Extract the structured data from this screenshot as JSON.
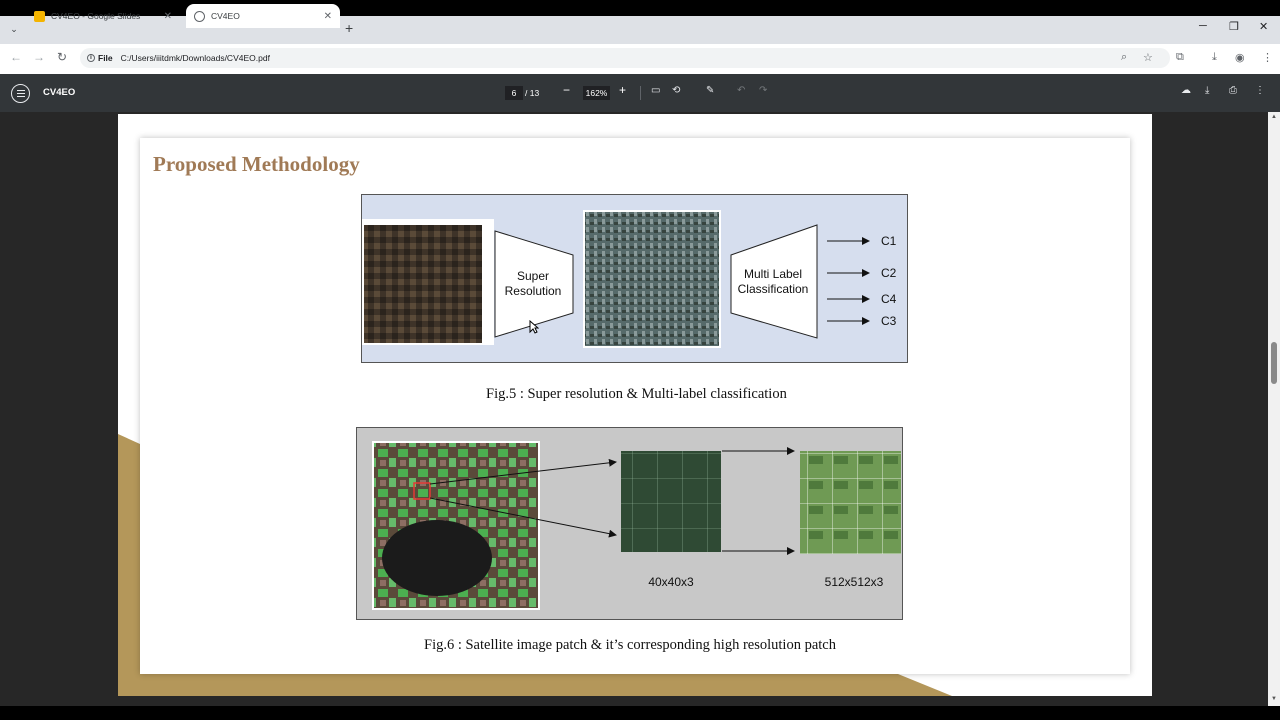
{
  "browser": {
    "tabs": [
      {
        "title": "CV4EO - Google Slides",
        "icon": "google-slides-icon",
        "icon_color": "#f4b400"
      },
      {
        "title": "CV4EO",
        "icon": "globe-icon",
        "active": true
      }
    ],
    "address": {
      "chip": "File",
      "url": "C:/Users/iiitdmk/Downloads/CV4EO.pdf"
    }
  },
  "pdf_toolbar": {
    "title": "CV4EO",
    "page_current": "6",
    "page_total": "/ 13",
    "zoom": "162%"
  },
  "slide": {
    "heading": "Proposed Methodology",
    "fig5": {
      "box1_label_line1": "Super",
      "box1_label_line2": "Resolution",
      "box2_label_line1": "Multi Label",
      "box2_label_line2": "Classification",
      "outputs": [
        "C1",
        "C2",
        "C4",
        "C3"
      ],
      "caption": "Fig.5 : Super resolution & Multi-label classification"
    },
    "fig6": {
      "low_res_label": "40x40x3",
      "high_res_label": "512x512x3",
      "caption": "Fig.6 : Satellite image patch & it’s corresponding high resolution patch"
    }
  },
  "colors": {
    "heading": "#a07a56",
    "slide_accent_gold": "#b4975a",
    "pdf_toolbar": "#323639",
    "viewer_bg": "#272727"
  }
}
